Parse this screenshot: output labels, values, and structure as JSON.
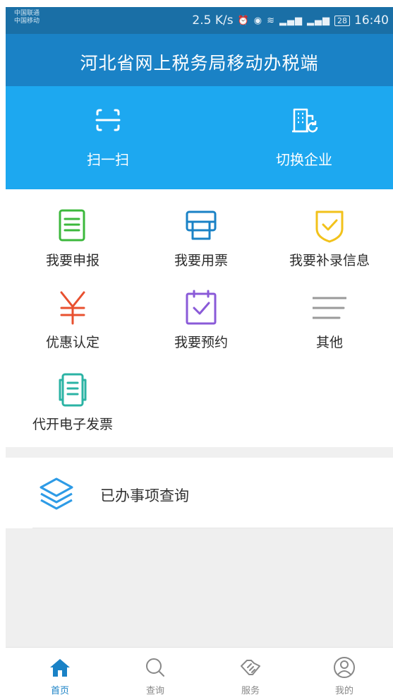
{
  "status_bar": {
    "carrier_1": "中国联通",
    "carrier_2": "中国移动",
    "speed": "2.5 K/s",
    "battery": "28",
    "time": "16:40"
  },
  "app": {
    "title": "河北省网上税务局移动办税端"
  },
  "quick_actions": [
    {
      "label": "扫一扫",
      "icon": "scan-icon"
    },
    {
      "label": "切换企业",
      "icon": "building-switch-icon"
    }
  ],
  "grid": [
    {
      "label": "我要申报",
      "icon": "declare-doc-icon",
      "color": "#3cb83c"
    },
    {
      "label": "我要用票",
      "icon": "printer-icon",
      "color": "#1a82c6"
    },
    {
      "label": "我要补录信息",
      "icon": "shield-check-icon",
      "color": "#f2c21b"
    },
    {
      "label": "优惠认定",
      "icon": "yen-icon",
      "color": "#e8502f"
    },
    {
      "label": "我要预约",
      "icon": "calendar-check-icon",
      "color": "#8a5ad8"
    },
    {
      "label": "其他",
      "icon": "menu-lines-icon",
      "color": "#9a9a9a"
    },
    {
      "label": "代开电子发票",
      "icon": "invoice-icon",
      "color": "#2bb3a4"
    }
  ],
  "query": {
    "label": "已办事项查询",
    "icon": "layers-icon",
    "color": "#2e9be6"
  },
  "tabs": [
    {
      "label": "首页",
      "icon": "home-icon",
      "active": true
    },
    {
      "label": "查询",
      "icon": "search-icon",
      "active": false
    },
    {
      "label": "服务",
      "icon": "handshake-icon",
      "active": false
    },
    {
      "label": "我的",
      "icon": "user-icon",
      "active": false
    }
  ],
  "colors": {
    "primary": "#1a82c6",
    "accent": "#1da8f0",
    "status_bar": "#1a6fa6"
  }
}
